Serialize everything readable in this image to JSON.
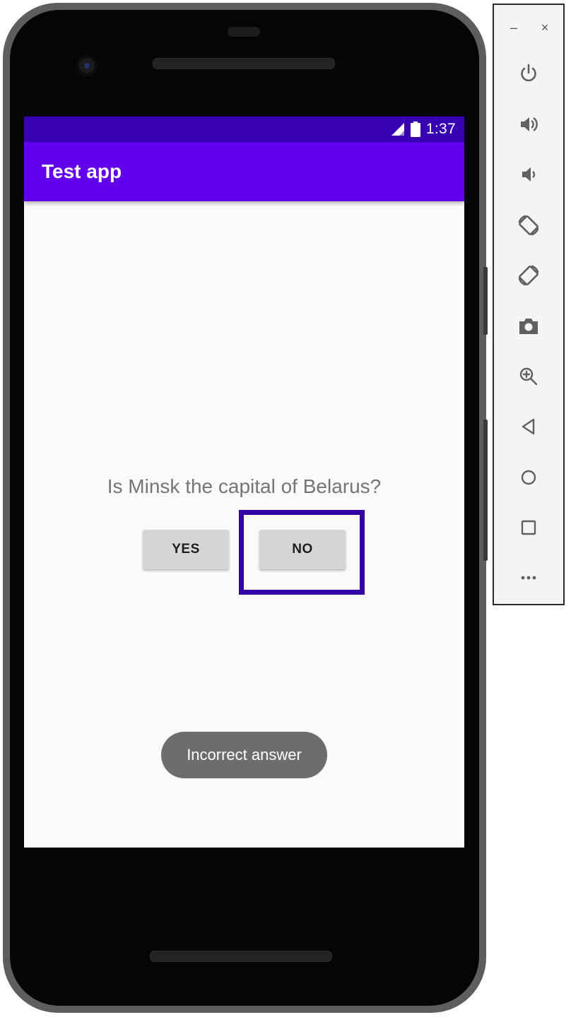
{
  "status_bar": {
    "time": "1:37",
    "background": "#3700b3"
  },
  "app_bar": {
    "title": "Test app",
    "background": "#6200ee"
  },
  "content": {
    "question": "Is Minsk the capital of Belarus?",
    "yes_label": "YES",
    "no_label": "NO",
    "toast": "Incorrect answer"
  },
  "highlight": {
    "target": "no-button",
    "color": "#3300a8"
  },
  "toolbar": {
    "window_controls": [
      {
        "name": "minimize-icon",
        "glyph": "–"
      },
      {
        "name": "close-icon",
        "glyph": "×"
      }
    ],
    "buttons": [
      "power-icon",
      "volume-up-icon",
      "volume-down-icon",
      "rotate-left-icon",
      "rotate-right-icon",
      "camera-icon",
      "zoom-icon",
      "back-icon",
      "home-icon",
      "overview-icon",
      "more-icon"
    ]
  }
}
